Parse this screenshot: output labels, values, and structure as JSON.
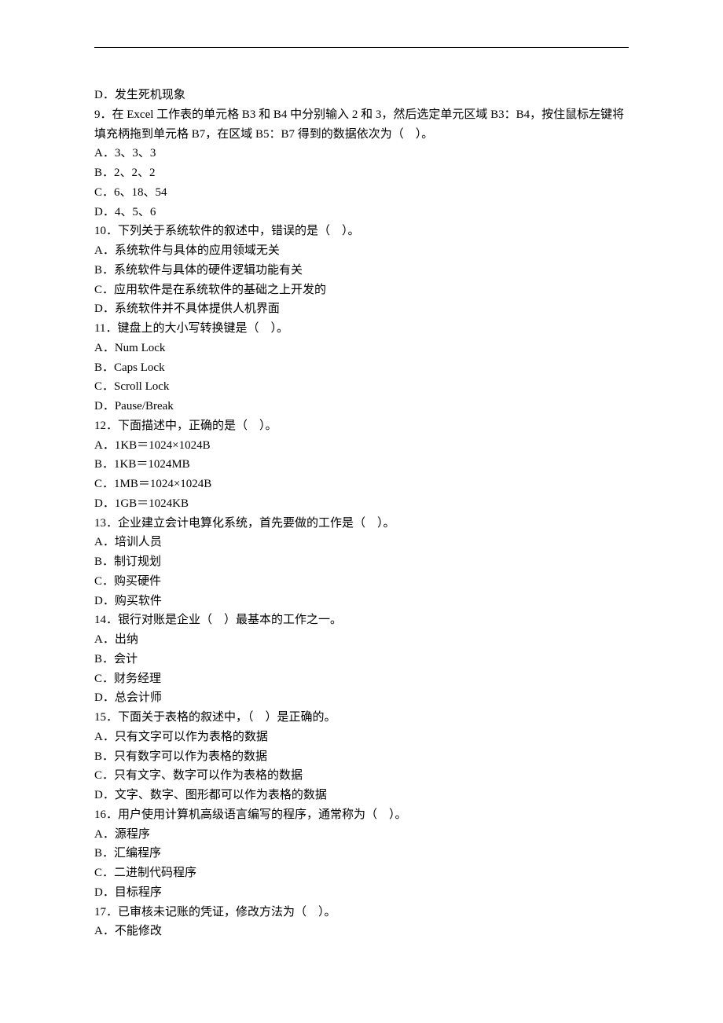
{
  "lines": [
    "D．发生死机现象",
    "9．在 Excel 工作表的单元格 B3 和 B4 中分别输入 2 和 3，然后选定单元区域 B3：B4，按住鼠标左键将填充柄拖到单元格 B7，在区域 B5：B7 得到的数据依次为（　）。",
    "A．3、3、3",
    "B．2、2、2",
    "C．6、18、54",
    "D．4、5、6",
    "10．下列关于系统软件的叙述中，错误的是（　）。",
    "A．系统软件与具体的应用领域无关",
    "B．系统软件与具体的硬件逻辑功能有关",
    "C．应用软件是在系统软件的基础之上开发的",
    "D．系统软件并不具体提供人机界面",
    "11．键盘上的大小写转换键是（　）。",
    "A．Num Lock",
    "B．Caps Lock",
    "C．Scroll Lock",
    "D．Pause/Break",
    "12．下面描述中，正确的是（　）。",
    "A．1KB＝1024×1024B",
    "B．1KB＝1024MB",
    "C．1MB＝1024×1024B",
    "D．1GB＝1024KB",
    "13．企业建立会计电算化系统，首先要做的工作是（　）。",
    "A．培训人员",
    "B．制订规划",
    "C．购买硬件",
    "D．购买软件",
    "14．银行对账是企业（　）最基本的工作之一。",
    "A．出纳",
    "B．会计",
    "C．财务经理",
    "D．总会计师",
    "15．下面关于表格的叙述中，（　）是正确的。",
    "A．只有文字可以作为表格的数据",
    "B．只有数字可以作为表格的数据",
    "C．只有文字、数字可以作为表格的数据",
    "D．文字、数字、图形都可以作为表格的数据",
    "16．用户使用计算机高级语言编写的程序，通常称为（　）。",
    "A．源程序",
    "B．汇编程序",
    "C．二进制代码程序",
    "D．目标程序",
    "17．已审核未记账的凭证，修改方法为（　）。",
    "A．不能修改"
  ]
}
